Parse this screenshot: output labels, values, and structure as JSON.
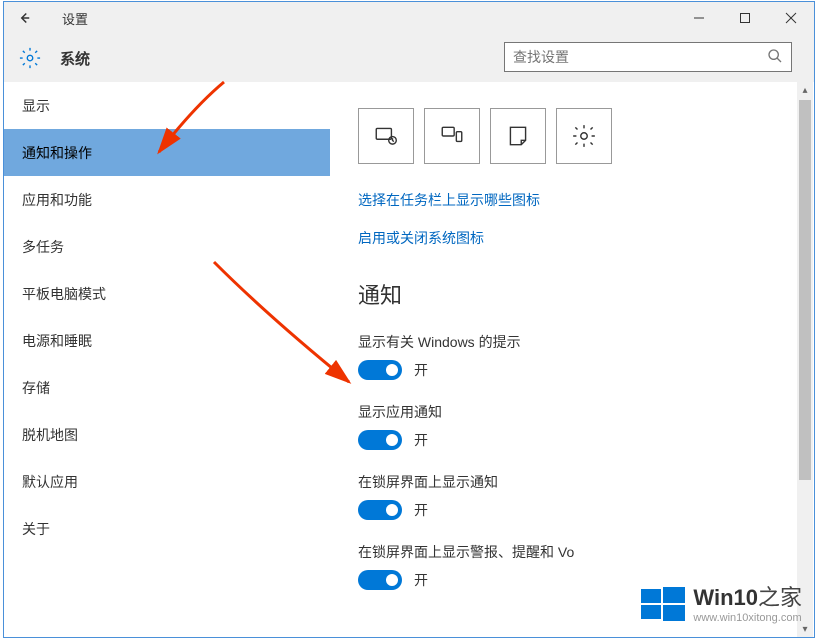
{
  "titlebar": {
    "title": "设置"
  },
  "header": {
    "system_label": "系统",
    "search_placeholder": "查找设置"
  },
  "sidebar": {
    "items": [
      {
        "label": "显示",
        "selected": false
      },
      {
        "label": "通知和操作",
        "selected": true
      },
      {
        "label": "应用和功能",
        "selected": false
      },
      {
        "label": "多任务",
        "selected": false
      },
      {
        "label": "平板电脑模式",
        "selected": false
      },
      {
        "label": "电源和睡眠",
        "selected": false
      },
      {
        "label": "存储",
        "selected": false
      },
      {
        "label": "脱机地图",
        "selected": false
      },
      {
        "label": "默认应用",
        "selected": false
      },
      {
        "label": "关于",
        "selected": false
      }
    ]
  },
  "content": {
    "links": {
      "taskbar_icons": "选择在任务栏上显示哪些图标",
      "system_icons": "启用或关闭系统图标"
    },
    "section_title": "通知",
    "toggles": [
      {
        "label": "显示有关 Windows 的提示",
        "state": "开"
      },
      {
        "label": "显示应用通知",
        "state": "开"
      },
      {
        "label": "在锁屏界面上显示通知",
        "state": "开"
      },
      {
        "label": "在锁屏界面上显示警报、提醒和 Vo",
        "state": "开"
      }
    ]
  },
  "watermark": {
    "brand_main": "Win10",
    "brand_suffix": "之家",
    "url": "www.win10xitong.com"
  }
}
